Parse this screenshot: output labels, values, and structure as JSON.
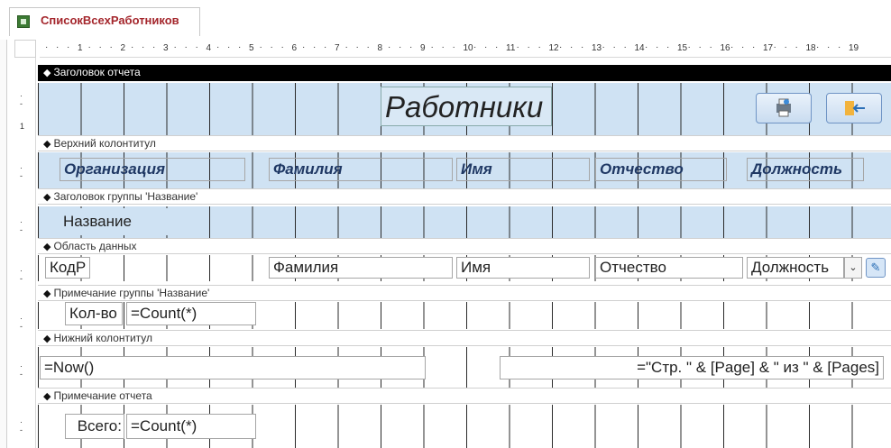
{
  "tab": {
    "title": "СписокВсехРаботников"
  },
  "ruler": {
    "marks": [
      "1",
      "2",
      "3",
      "4",
      "5",
      "6",
      "7",
      "8",
      "9",
      "10",
      "11",
      "12",
      "13",
      "14",
      "15",
      "16",
      "17",
      "18",
      "19"
    ],
    "vmark": "1"
  },
  "sections": {
    "report_header": "Заголовок отчета",
    "page_header": "Верхний колонтитул",
    "group_header": "Заголовок группы 'Название'",
    "detail": "Область данных",
    "group_footer": "Примечание группы 'Название'",
    "page_footer": "Нижний колонтитул",
    "report_footer": "Примечание отчета"
  },
  "report_header": {
    "title": "Работники"
  },
  "page_header": {
    "labels": [
      "Организация",
      "Фамилия",
      "Имя",
      "Отчество",
      "Должность"
    ]
  },
  "group_header": {
    "field": "Название"
  },
  "detail": {
    "kod": "КодР",
    "familia": "Фамилия",
    "imya": "Имя",
    "otchestvo": "Отчество",
    "dolzhnost": "Должность"
  },
  "group_footer": {
    "label": "Кол-во",
    "expr": "=Count(*)"
  },
  "page_footer": {
    "date": "=Now()",
    "page": "=\"Стр. \" & [Page] & \" из \" & [Pages]"
  },
  "report_footer": {
    "label": "Всего:",
    "expr": "=Count(*)"
  },
  "colors": {
    "tab_text": "#a4262c",
    "header_band": "#cfe2f3",
    "header_label": "#1f3864"
  }
}
